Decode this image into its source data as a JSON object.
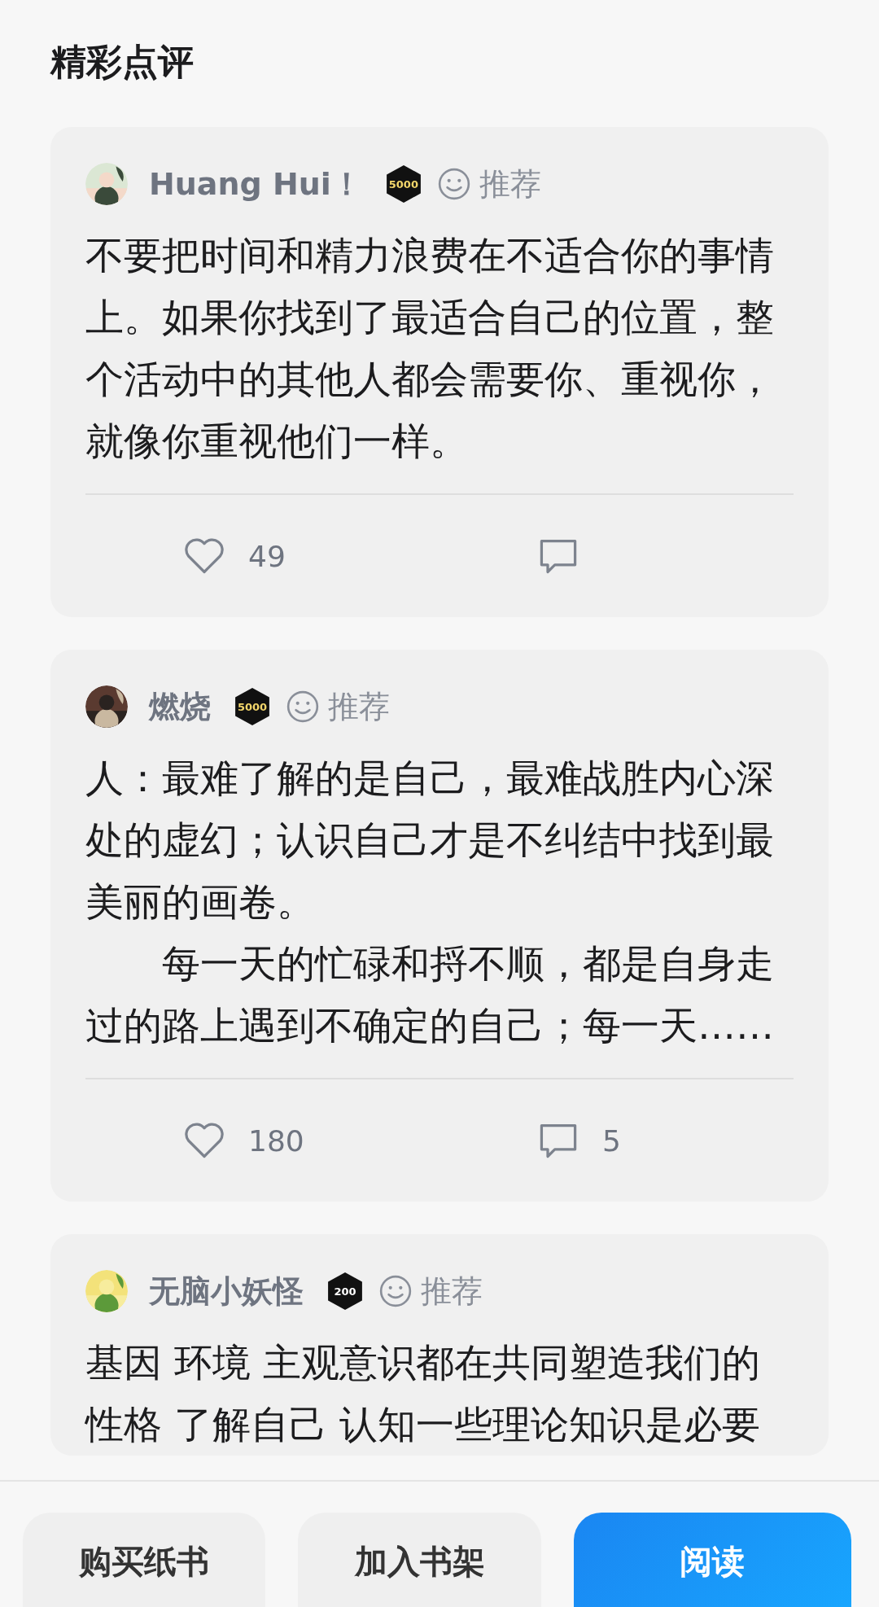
{
  "section_title": "精彩点评",
  "reviews": [
    {
      "user": "Huang Hui！",
      "badge": {
        "text": "5000",
        "color": "#f3d66b"
      },
      "tag": "推荐",
      "paragraphs": [
        {
          "text": "不要把时间和精力浪费在不适合你的事情上。如果你找到了最适合自己的位置，整个活动中的其他人都会需要你、重视你，就像你重视他们一样。",
          "indent": false
        }
      ],
      "likes": "49"
    },
    {
      "user": "燃烧",
      "badge": {
        "text": "5000",
        "color": "#f3d66b"
      },
      "tag": "推荐",
      "paragraphs": [
        {
          "text": "人：最难了解的是自己，最难战胜内心深处的虚幻；认识自己才是不纠结中找到最美丽的画卷。",
          "indent": false
        },
        {
          "text": "每一天的忙碌和捋不顺，都是自身走过的路上遇到不确定的自己；每一天……",
          "indent": true
        }
      ],
      "likes": "180",
      "comments": "5"
    },
    {
      "user": "无脑小妖怪",
      "badge": {
        "text": "200",
        "color": "#ffffff"
      },
      "tag": "推荐",
      "paragraphs": [
        {
          "text": "基因 环境 主观意识都在共同塑造我们的性格 了解自己 认知一些理论知识是必要",
          "indent": false
        }
      ]
    }
  ],
  "buttons": [
    {
      "label": "购买纸书",
      "kind": "plain"
    },
    {
      "label": "加入书架",
      "kind": "plain"
    },
    {
      "label": "阅读",
      "kind": "primary"
    }
  ]
}
